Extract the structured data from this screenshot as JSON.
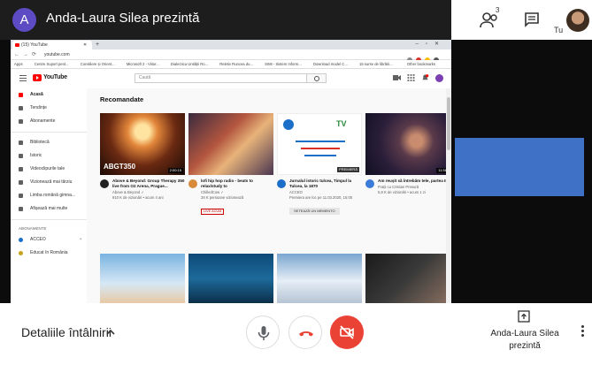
{
  "meet": {
    "presenter_initial": "A",
    "presenter_title": "Anda-Laura Silea prezintă",
    "participants_count": "3",
    "self_label": "Tu",
    "details_label": "Detaliile întâlnirii",
    "presenting_label": "Anda-Laura Silea prezintă",
    "colors": {
      "topbar": "#1d1d1d",
      "avatar": "#5c4bc2",
      "end_call": "#ea4335",
      "tile": "#3f72c7"
    }
  },
  "browser": {
    "tab_title": "(15) YouTube",
    "new_tab": "+",
    "url": "youtube.com",
    "bookmarks": [
      "Apps",
      "Centre Suport pent...",
      "Consiliere și Orient...",
      "Microsoft 2 - Viitor...",
      "Dialectica Unității Ro...",
      "Reletiv Runcea du...",
      "SIMI - Sistem Inform...",
      "Download model C...",
      "15 surse de librării..."
    ],
    "other_bookmarks": "Other bookmarks"
  },
  "youtube": {
    "logo_text": "YouTube",
    "search_placeholder": "Caută",
    "section_title": "Recomandate",
    "sidebar": {
      "items": [
        {
          "label": "Acasă",
          "icon": "home-icon",
          "active": true
        },
        {
          "label": "Tendințe",
          "icon": "fire-icon"
        },
        {
          "label": "Abonamente",
          "icon": "subscriptions-icon"
        }
      ],
      "library_items": [
        {
          "label": "Bibliotecă",
          "icon": "library-icon"
        },
        {
          "label": "Istoric",
          "icon": "history-icon"
        },
        {
          "label": "Videoclipurile tale",
          "icon": "my-videos-icon"
        },
        {
          "label": "Vizionează mai târziu",
          "icon": "watch-later-icon"
        },
        {
          "label": "Limba română gimna...",
          "icon": "playlist-icon"
        },
        {
          "label": "Afișează mai multe",
          "icon": "expand-icon"
        }
      ],
      "subscriptions_heading": "ABONAMENTE",
      "subscriptions": [
        {
          "label": "ACCEO",
          "icon": "channel-icon"
        },
        {
          "label": "Educat în România",
          "icon": "channel-icon"
        }
      ]
    },
    "videos": [
      {
        "title": "Above & Beyond: Group Therapy 350 live from O2 Arena, Prague...",
        "channel": "Above & Beyond ✓",
        "stats": "910 K de vizionări • acum 4 ani",
        "duration": "2:00:15",
        "thumb_text": "ABGT350",
        "badge": ""
      },
      {
        "title": "lofi hip hop radio - beats to relax/study to",
        "channel": "ChilledCow ✓",
        "stats": "28 K persoane vizionează",
        "duration": "",
        "thumb_text": "",
        "badge": "LIVE ACUM"
      },
      {
        "title": "Jurnalul istoric tulcea, Timpul la Tulcea, la 1870",
        "channel": "ACCEO",
        "stats": "Premiera are loc pe 11.03.2020, 15:00",
        "duration": "PREMIERĂ",
        "thumb_text": "",
        "badge": "SETEAZĂ UN MEMENTO"
      },
      {
        "title": "Am reușit să întrebăm tele, partea II-a",
        "channel": "Frații cu Cristian Presură",
        "stats": "5,8 K de vizionări • acum 1 zi",
        "duration": "11:56",
        "thumb_text": "",
        "badge": ""
      }
    ]
  }
}
